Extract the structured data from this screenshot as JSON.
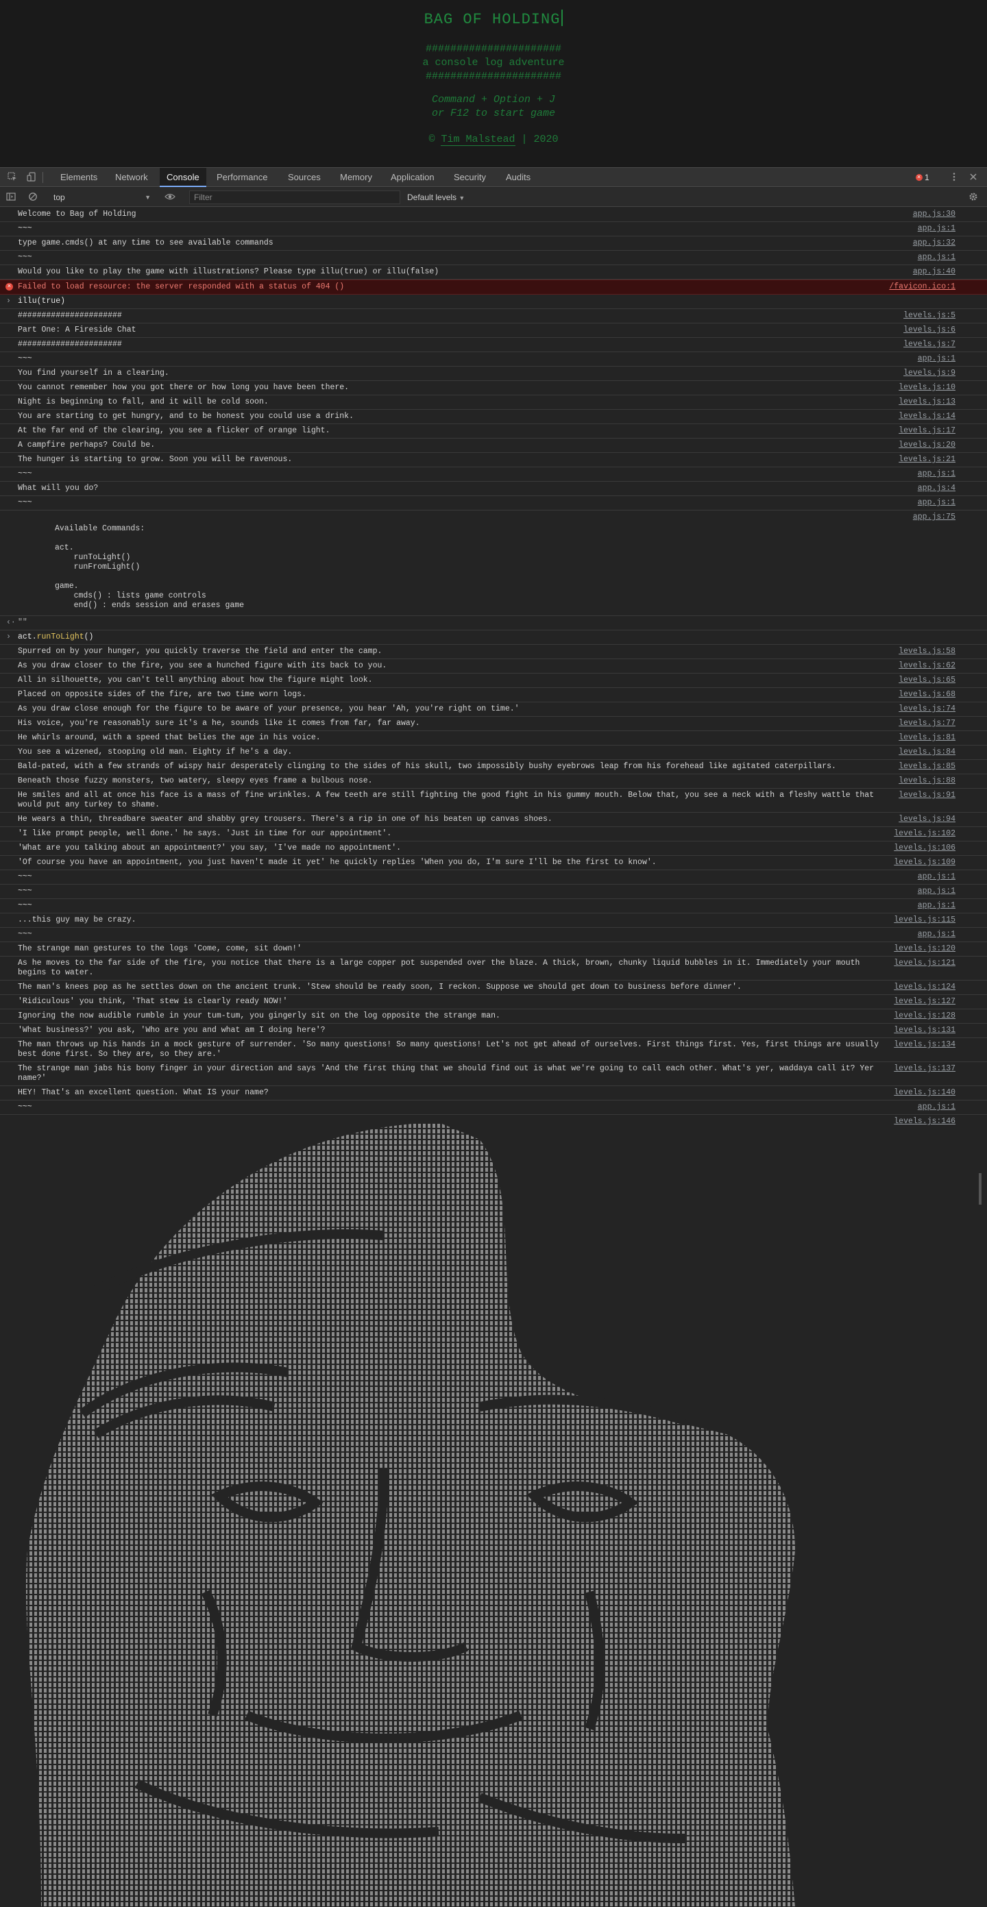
{
  "game": {
    "title": "BAG OF HOLDING",
    "rule": "######################",
    "subtitle": "a console log adventure",
    "instruction_1": "Command + Option + J",
    "instruction_2": "or F12 to start game",
    "credit_symbol": "©",
    "credit_name": "Tim Malstead",
    "credit_year": "| 2020"
  },
  "devtools": {
    "tabs": [
      "Elements",
      "Network",
      "Console",
      "Performance",
      "Sources",
      "Memory",
      "Application",
      "Security",
      "Audits"
    ],
    "active_tab": "Console",
    "error_count": "1",
    "context": "top",
    "filter_placeholder": "Filter",
    "levels": "Default levels",
    "icons": {
      "inspect": "inspect-element-icon",
      "device": "device-toggle-icon",
      "error": "error-badge-icon",
      "more": "kebab-menu-icon",
      "close": "close-icon",
      "sidebar": "sidebar-toggle-icon",
      "clear": "clear-console-icon",
      "eye": "live-expression-icon",
      "settings": "gear-icon"
    }
  },
  "console": {
    "messages": [
      {
        "type": "log",
        "text": "Welcome to Bag of Holding",
        "src": "app.js:30"
      },
      {
        "type": "log",
        "text": "~~~",
        "src": "app.js:1"
      },
      {
        "type": "log",
        "text": "type game.cmds() at any time to see available commands",
        "src": "app.js:32"
      },
      {
        "type": "log",
        "text": "~~~",
        "src": "app.js:1"
      },
      {
        "type": "log",
        "text": "Would you like to play the game with illustrations? Please type illu(true) or illu(false)",
        "src": "app.js:40"
      },
      {
        "type": "error",
        "text": "Failed to load resource: the server responded with a status of 404 ()",
        "src": "/favicon.ico:1"
      },
      {
        "type": "input",
        "text": "illu(true)"
      },
      {
        "type": "log",
        "text": "######################",
        "src": "levels.js:5"
      },
      {
        "type": "log",
        "text": "Part One: A Fireside Chat",
        "src": "levels.js:6"
      },
      {
        "type": "log",
        "text": "######################",
        "src": "levels.js:7"
      },
      {
        "type": "log",
        "text": "~~~",
        "src": "app.js:1"
      },
      {
        "type": "log",
        "text": "You find yourself in a clearing.",
        "src": "levels.js:9"
      },
      {
        "type": "log",
        "text": "You cannot remember how you got there or how long you have been there.",
        "src": "levels.js:10"
      },
      {
        "type": "log",
        "text": "Night is beginning to fall, and it will be cold soon.",
        "src": "levels.js:13"
      },
      {
        "type": "log",
        "text": "You are starting to get hungry, and to be honest you could use a drink.",
        "src": "levels.js:14"
      },
      {
        "type": "log",
        "text": "At the far end of the clearing, you see a flicker of orange light.",
        "src": "levels.js:17"
      },
      {
        "type": "log",
        "text": "A campfire perhaps? Could be.",
        "src": "levels.js:20"
      },
      {
        "type": "log",
        "text": "The hunger is starting to grow. Soon you will be ravenous.",
        "src": "levels.js:21"
      },
      {
        "type": "log",
        "text": "~~~",
        "src": "app.js:1"
      },
      {
        "type": "log",
        "text": "What will you do?",
        "src": "app.js:4"
      },
      {
        "type": "log",
        "text": "~~~",
        "src": "app.js:1"
      },
      {
        "type": "commands",
        "text": "\nAvailable Commands:\n\nact.\n    runToLight()\n    runFromLight()\n\ngame.\n    cmds() : lists game controls\n    end() : ends session and erases game",
        "src": "app.js:75"
      },
      {
        "type": "result",
        "text": "\"\""
      },
      {
        "type": "input2",
        "obj": "act.",
        "fn": "runToLight",
        "tail": "()"
      },
      {
        "type": "log",
        "text": "Spurred on by your hunger, you quickly traverse the field and enter the camp.",
        "src": "levels.js:58"
      },
      {
        "type": "log",
        "text": "As you draw closer to the fire, you see a hunched figure with its back to you.",
        "src": "levels.js:62"
      },
      {
        "type": "log",
        "text": "All in silhouette, you can't tell anything about how the figure might look.",
        "src": "levels.js:65"
      },
      {
        "type": "log",
        "text": "Placed on opposite sides of the fire, are two time worn logs.",
        "src": "levels.js:68"
      },
      {
        "type": "log",
        "text": "As you draw close enough for the figure to be aware of your presence, you hear 'Ah, you're right on time.'",
        "src": "levels.js:74"
      },
      {
        "type": "log",
        "text": "His voice, you're reasonably sure it's a he, sounds like it comes from far, far away.",
        "src": "levels.js:77"
      },
      {
        "type": "log",
        "text": "He whirls around, with a speed that belies the age in his voice.",
        "src": "levels.js:81"
      },
      {
        "type": "log",
        "text": "You see a wizened, stooping old man. Eighty if he's a day.",
        "src": "levels.js:84"
      },
      {
        "type": "log",
        "text": "Bald-pated, with a few strands of wispy hair desperately clinging to the sides of his skull, two impossibly bushy eyebrows leap from his forehead like agitated caterpillars.",
        "src": "levels.js:85"
      },
      {
        "type": "log",
        "text": "Beneath those fuzzy monsters, two watery, sleepy eyes frame a bulbous nose.",
        "src": "levels.js:88"
      },
      {
        "type": "log",
        "text": "He smiles and all at once his face is a mass of fine wrinkles. A few teeth are still fighting the good fight in his gummy mouth. Below that, you see a neck with a fleshy wattle that would put any turkey to shame.",
        "src": "levels.js:91"
      },
      {
        "type": "log",
        "text": "He wears a thin, threadbare sweater and shabby grey trousers. There's a rip in one of his beaten up canvas shoes.",
        "src": "levels.js:94"
      },
      {
        "type": "log",
        "text": "'I like prompt people, well done.' he says. 'Just in time for our appointment'.",
        "src": "levels.js:102"
      },
      {
        "type": "log",
        "text": "'What are you talking about an appointment?' you say, 'I've made no appointment'.",
        "src": "levels.js:106"
      },
      {
        "type": "log",
        "text": "'Of course you have an appointment, you just haven't made it yet' he quickly replies 'When you do, I'm sure I'll be the first to know'.",
        "src": "levels.js:109"
      },
      {
        "type": "log",
        "text": "~~~",
        "src": "app.js:1"
      },
      {
        "type": "log",
        "text": "~~~",
        "src": "app.js:1"
      },
      {
        "type": "log",
        "text": "~~~",
        "src": "app.js:1"
      },
      {
        "type": "log",
        "text": "...this guy may be crazy.",
        "src": "levels.js:115"
      },
      {
        "type": "log",
        "text": "~~~",
        "src": "app.js:1"
      },
      {
        "type": "log",
        "text": "The strange man gestures to the logs 'Come, come, sit down!'",
        "src": "levels.js:120"
      },
      {
        "type": "log",
        "text": "As he moves to the far side of the fire, you notice that there is a large copper pot suspended over the blaze. A thick, brown, chunky liquid bubbles in it. Immediately your mouth begins to water.",
        "src": "levels.js:121"
      },
      {
        "type": "log",
        "text": "The man's knees pop as he settles down on the ancient trunk. 'Stew should be ready soon, I reckon. Suppose we should get down to business before dinner'.",
        "src": "levels.js:124"
      },
      {
        "type": "log",
        "text": "'Ridiculous' you think, 'That stew is clearly ready NOW!'",
        "src": "levels.js:127"
      },
      {
        "type": "log",
        "text": "Ignoring the now audible rumble in your tum-tum, you gingerly sit on the log opposite the strange man.",
        "src": "levels.js:128"
      },
      {
        "type": "log",
        "text": "'What business?' you ask, 'Who are you and what am I doing here'?",
        "src": "levels.js:131"
      },
      {
        "type": "log",
        "text": "The man throws up his hands in a mock gesture of surrender. 'So many questions! So many questions! Let's not get ahead of ourselves. First things first. Yes, first things are usually best done first. So they are, so they are.'",
        "src": "levels.js:134"
      },
      {
        "type": "log",
        "text": "The strange man jabs his bony finger in your direction and says 'And the first thing that we should find out is what we're going to call each other. What's yer, waddaya call it? Yer name?'",
        "src": "levels.js:137"
      },
      {
        "type": "log",
        "text": "HEY! That's an excellent question. What IS your name?",
        "src": "levels.js:140"
      },
      {
        "type": "log",
        "text": "~~~",
        "src": "app.js:1"
      },
      {
        "type": "art",
        "text": "",
        "src": "levels.js:146",
        "art_name": "ascii-portrait-old-man"
      }
    ]
  }
}
